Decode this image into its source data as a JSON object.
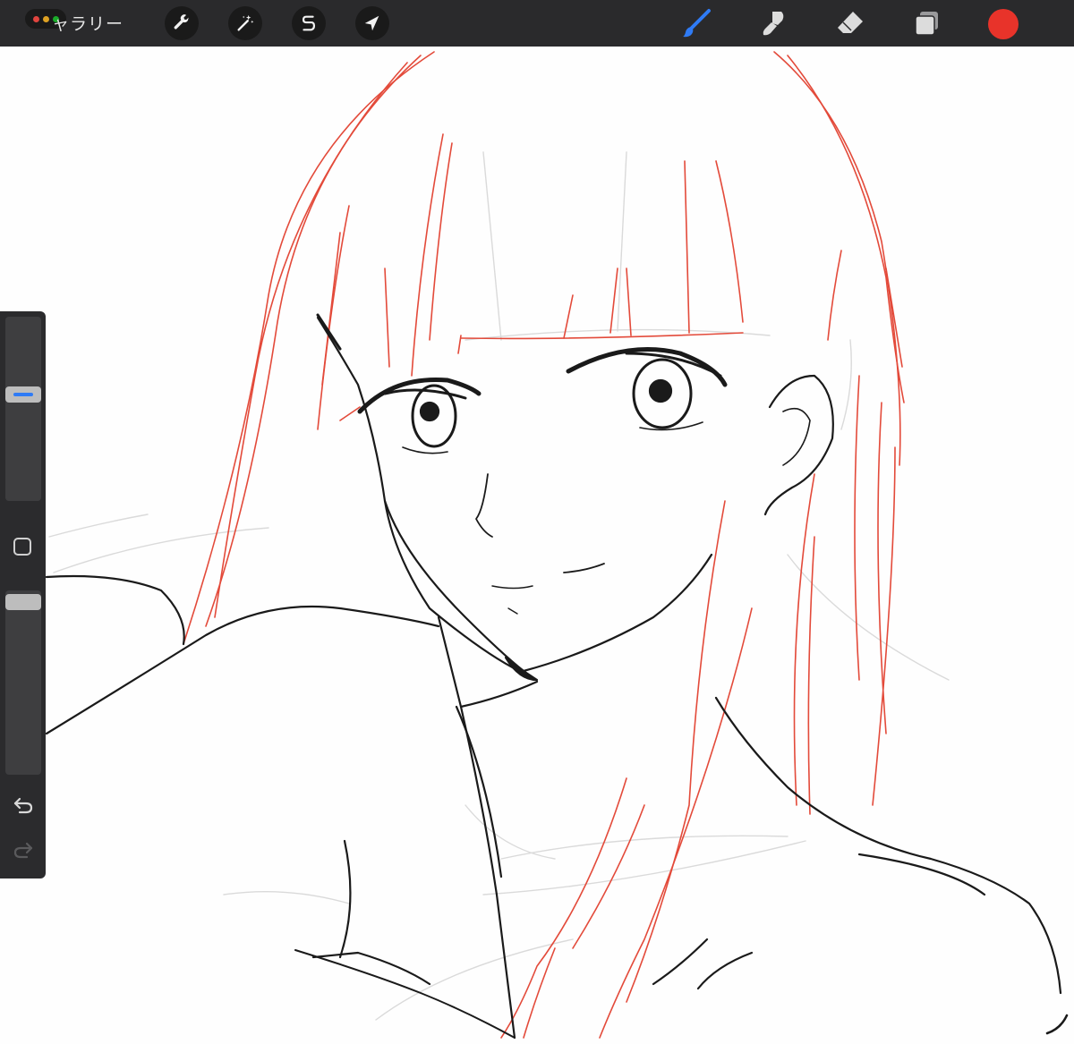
{
  "toolbar": {
    "gallery_label": "ャラリー",
    "window_dot_colors": [
      "#e0443e",
      "#dea123",
      "#1aab29"
    ],
    "left_tools": [
      {
        "name": "actions",
        "icon": "wrench-icon"
      },
      {
        "name": "adjustments",
        "icon": "magic-wand-icon"
      },
      {
        "name": "selection",
        "icon": "selection-s-icon"
      },
      {
        "name": "transform",
        "icon": "arrow-cursor-icon"
      }
    ],
    "right_tools": [
      {
        "name": "brush",
        "icon": "brush-icon",
        "active": true
      },
      {
        "name": "smudge",
        "icon": "smudge-icon",
        "active": false
      },
      {
        "name": "eraser",
        "icon": "eraser-icon",
        "active": false
      },
      {
        "name": "layers",
        "icon": "layers-icon",
        "active": false
      }
    ],
    "current_color": "#e8332a",
    "active_tool_color": "#2f7bf5"
  },
  "sidebar": {
    "brush_size_slider": {
      "label_icon": "size-slider",
      "active_color": "#2f7bf5"
    },
    "modify_button": {
      "icon": "square-icon"
    },
    "opacity_slider": {
      "label_icon": "opacity-slider"
    },
    "undo": {
      "icon": "undo-icon"
    },
    "redo": {
      "icon": "redo-icon"
    }
  },
  "canvas": {
    "background": "#fefefe",
    "sketch_colors": {
      "line": "#1a1a1a",
      "guide": "#e34a3a",
      "faint": "#d8d8d8"
    }
  }
}
